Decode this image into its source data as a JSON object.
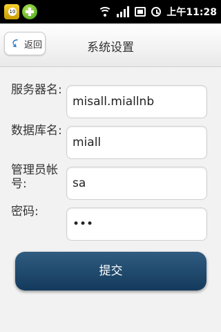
{
  "status_bar": {
    "app1_badge": "10",
    "time": "上午11:28"
  },
  "header": {
    "back_label": "返回",
    "title": "系统设置"
  },
  "form": {
    "server_label": "服务器名:",
    "server_value": "misall.miallnb",
    "database_label": "数据库名:",
    "database_value": "miall",
    "account_label_line1": "管理员帐",
    "account_label_line2": "号:",
    "account_value": "sa",
    "password_label": "密码:",
    "password_value": "•••"
  },
  "submit_label": "提交",
  "colors": {
    "submit_button": "#1d4668",
    "background": "#f2f2f2",
    "status_bar": "#000000"
  }
}
